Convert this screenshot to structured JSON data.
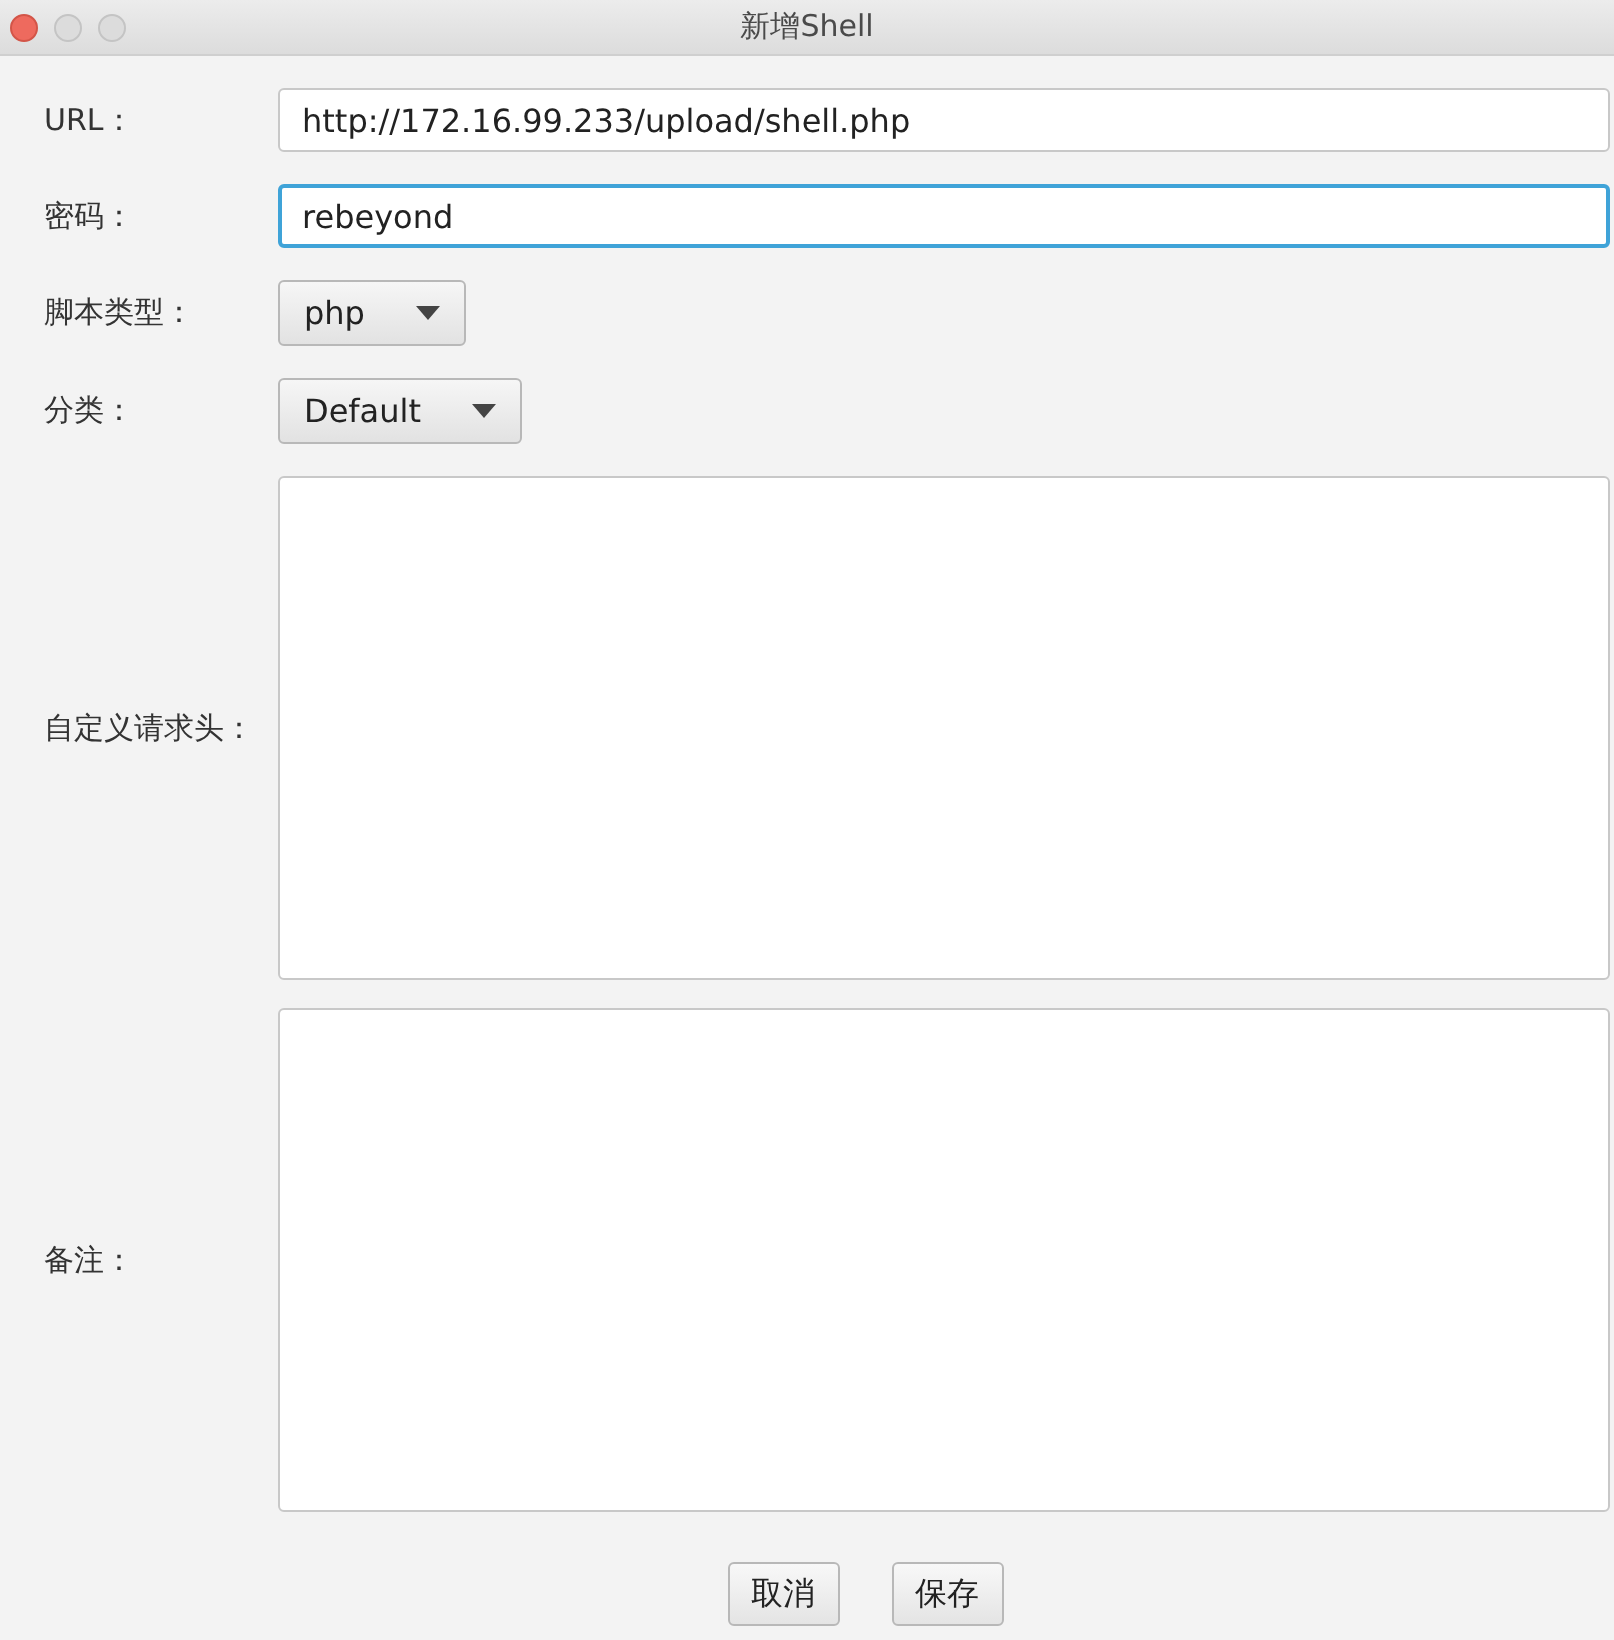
{
  "window": {
    "title": "新增Shell"
  },
  "fields": [
    {
      "kind": "text",
      "label": "URL：",
      "value": "http://172.16.99.233/upload/shell.php",
      "focused": false
    },
    {
      "kind": "text",
      "label": "密码：",
      "value": "rebeyond",
      "focused": true
    },
    {
      "kind": "select",
      "label": "脚本类型：",
      "value": "php"
    },
    {
      "kind": "select",
      "label": "分类：",
      "value": "Default"
    },
    {
      "kind": "textarea",
      "label": "自定义请求头："
    },
    {
      "kind": "textarea",
      "label": "备注："
    }
  ],
  "buttons": [
    "取消",
    "保存"
  ]
}
